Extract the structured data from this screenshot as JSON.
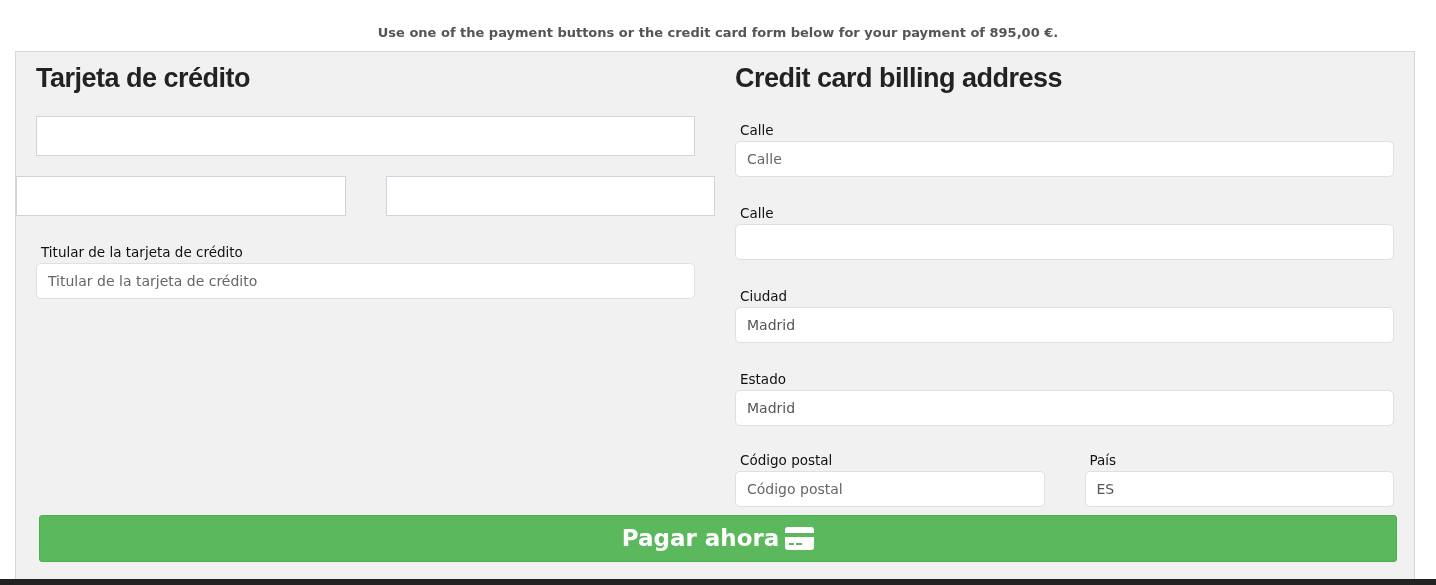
{
  "notice": "Use one of the payment buttons or the credit card form below for your payment of 895,00 €.",
  "card_section": {
    "title": "Tarjeta de crédito",
    "holder": {
      "label": "Titular de la tarjeta de crédito",
      "placeholder": "Titular de la tarjeta de crédito"
    }
  },
  "billing_section": {
    "title": "Credit card billing address",
    "fields": [
      {
        "label": "Calle",
        "placeholder": "Calle"
      },
      {
        "label": "Calle"
      },
      {
        "label": "Ciudad",
        "value": "Madrid"
      },
      {
        "label": "Estado",
        "value": "Madrid"
      }
    ],
    "half_fields": [
      {
        "label": "Código postal",
        "placeholder": "Código postal"
      },
      {
        "label": "País",
        "value": "ES"
      }
    ]
  },
  "pay_button": {
    "label": "Pagar ahora"
  }
}
